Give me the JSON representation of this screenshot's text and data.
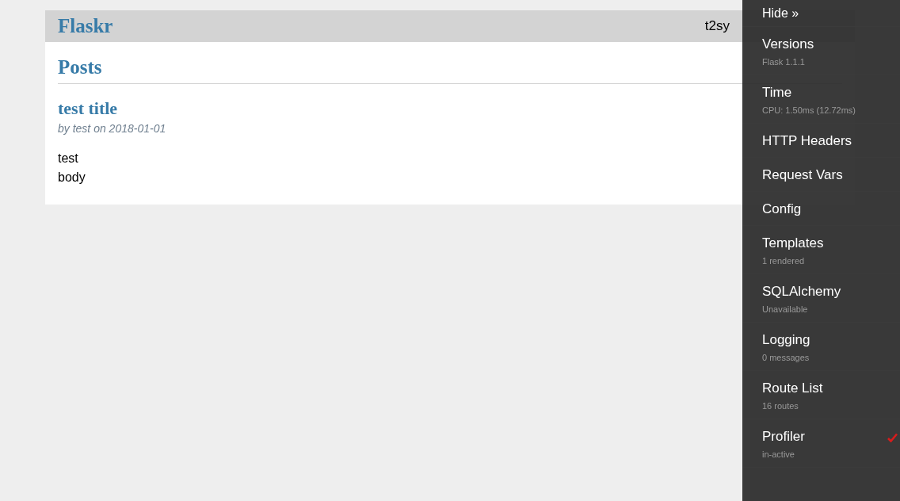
{
  "header": {
    "title": "Flaskr",
    "user": "t2sy"
  },
  "posts": {
    "heading": "Posts",
    "items": [
      {
        "title": "test title",
        "about": "by test on 2018-01-01",
        "body": [
          "test",
          "body"
        ]
      }
    ]
  },
  "debug_toolbar": {
    "hide": "Hide »",
    "panels": [
      {
        "kind": "panel",
        "title": "Versions",
        "subtitle": "Flask 1.1.1"
      },
      {
        "kind": "panel",
        "title": "Time",
        "subtitle": "CPU: 1.50ms (12.72ms)"
      },
      {
        "kind": "panel",
        "title": "HTTP Headers"
      },
      {
        "kind": "panel",
        "title": "Request Vars"
      },
      {
        "kind": "panel",
        "title": "Config"
      },
      {
        "kind": "panel",
        "title": "Templates",
        "subtitle": "1 rendered"
      },
      {
        "kind": "panel",
        "title": "SQLAlchemy",
        "subtitle": "Unavailable"
      },
      {
        "kind": "panel",
        "title": "Logging",
        "subtitle": "0 messages"
      },
      {
        "kind": "panel",
        "title": "Route List",
        "subtitle": "16 routes"
      },
      {
        "kind": "toggle",
        "title": "Profiler",
        "subtitle": "in-active",
        "checked": true
      }
    ]
  }
}
